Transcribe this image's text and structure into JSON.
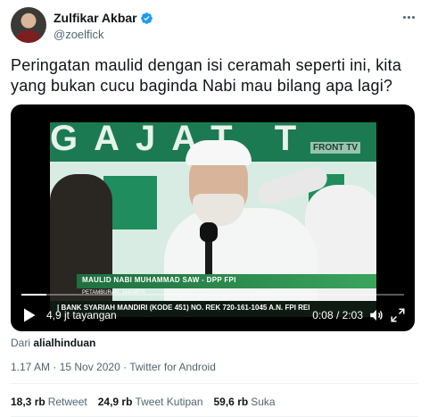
{
  "user": {
    "display_name": "Zulfikar Akbar",
    "handle": "@zoelfick"
  },
  "tweet": {
    "text": "Peringatan maulid dengan isi ceramah seperti ini, kita yang bukan cucu baginda Nabi mau bilang apa lagi?"
  },
  "video": {
    "views": "4,9 jt tayangan",
    "time": "0:08 / 2:03",
    "progress": 0.065,
    "overlay": {
      "banner": "GAJAT T",
      "channel_logo": "FRONT TV",
      "lower_third_title": "MAULID NABI MUHAMMAD SAW - DPP FPI",
      "lower_third_location": "PETAMBURAN, JAKARTA",
      "ticker": "| BANK SYARIAH MANDIRI (KODE 451) NO. REK 720-161-1045 A.N. FPI REI"
    }
  },
  "source": {
    "prefix": "Dari",
    "account": "alialhinduan"
  },
  "meta": {
    "timestamp": "1.17 AM · 15 Nov 2020 · Twitter for Android"
  },
  "stats": {
    "retweets_count": "18,3 rb",
    "retweets_label": "Retweet",
    "quotes_count": "24,9 rb",
    "quotes_label": "Tweet Kutipan",
    "likes_count": "59,6 rb",
    "likes_label": "Suka"
  },
  "colors": {
    "text_primary": "#0f1419",
    "text_secondary": "#536471",
    "verified": "#1d9bf0",
    "divider": "#eff3f4"
  },
  "icons": {
    "verified": "verified-badge-icon",
    "more": "more-dots-icon",
    "play": "play-icon",
    "volume": "volume-icon",
    "fullscreen": "fullscreen-icon"
  }
}
